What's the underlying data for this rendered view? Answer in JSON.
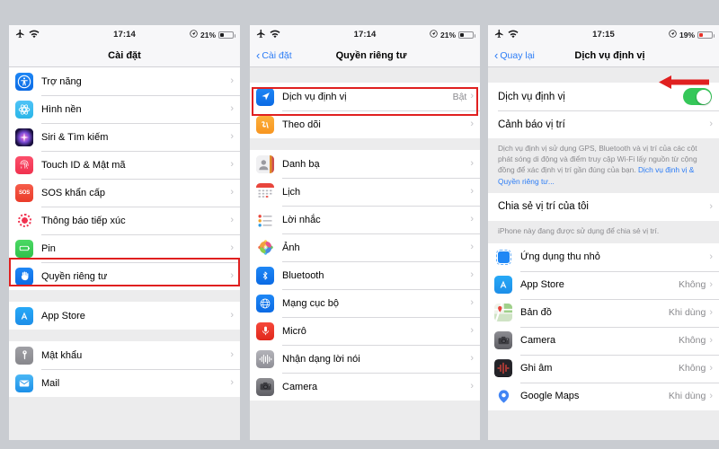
{
  "meta": {
    "background_color": "#c9ccd1",
    "accent_blue": "#2b7cf6",
    "highlight_red": "#e02020",
    "toggle_green": "#35c759"
  },
  "panel1": {
    "status": {
      "time": "17:14",
      "battery_percent": "21%",
      "airplane_icon": "airplane-icon",
      "wifi_icon": "wifi-icon",
      "location_icon": "location-arrow-icon"
    },
    "nav": {
      "title": "Cài đặt",
      "back_label": ""
    },
    "group1": [
      {
        "label": "Trợ năng",
        "icon": "accessibility-icon",
        "value": ""
      },
      {
        "label": "Hình nền",
        "icon": "wallpaper-icon",
        "value": ""
      },
      {
        "label": "Siri & Tìm kiếm",
        "icon": "siri-icon",
        "value": ""
      },
      {
        "label": "Touch ID & Mật mã",
        "icon": "touchid-icon",
        "value": ""
      },
      {
        "label": "SOS khẩn cấp",
        "icon": "sos-icon",
        "value": ""
      },
      {
        "label": "Thông báo tiếp xúc",
        "icon": "exposure-notification-icon",
        "value": ""
      },
      {
        "label": "Pin",
        "icon": "battery-icon",
        "value": ""
      },
      {
        "label": "Quyền riêng tư",
        "icon": "privacy-hand-icon",
        "value": ""
      }
    ],
    "group2": [
      {
        "label": "App Store",
        "icon": "app-store-icon",
        "value": ""
      }
    ],
    "group3": [
      {
        "label": "Mật khẩu",
        "icon": "passwords-key-icon",
        "value": ""
      },
      {
        "label": "Mail",
        "icon": "mail-icon",
        "value": ""
      }
    ]
  },
  "panel2": {
    "status": {
      "time": "17:14",
      "battery_percent": "21%"
    },
    "nav": {
      "back_label": "Cài đặt",
      "title": "Quyền riêng tư"
    },
    "group1": [
      {
        "label": "Dịch vụ định vị",
        "icon": "location-services-icon",
        "value": "Bật"
      },
      {
        "label": "Theo dõi",
        "icon": "tracking-icon",
        "value": ""
      }
    ],
    "group2": [
      {
        "label": "Danh bạ",
        "icon": "contacts-icon",
        "value": ""
      },
      {
        "label": "Lịch",
        "icon": "calendar-icon",
        "value": ""
      },
      {
        "label": "Lời nhắc",
        "icon": "reminders-icon",
        "value": ""
      },
      {
        "label": "Ảnh",
        "icon": "photos-icon",
        "value": ""
      },
      {
        "label": "Bluetooth",
        "icon": "bluetooth-icon",
        "value": ""
      },
      {
        "label": "Mạng cục bộ",
        "icon": "local-network-icon",
        "value": ""
      },
      {
        "label": "Micrô",
        "icon": "microphone-icon",
        "value": ""
      },
      {
        "label": "Nhận dạng lời nói",
        "icon": "speech-recognition-icon",
        "value": ""
      },
      {
        "label": "Camera",
        "icon": "camera-icon",
        "value": ""
      }
    ]
  },
  "panel3": {
    "status": {
      "time": "17:15",
      "battery_percent": "19%"
    },
    "nav": {
      "back_label": "Quay lại",
      "title": "Dịch vụ định vị"
    },
    "group1": [
      {
        "label": "Dịch vụ định vị",
        "value": "",
        "control": "toggle-on"
      },
      {
        "label": "Cảnh báo vị trí",
        "value": "",
        "control": "chevron"
      }
    ],
    "note1_text": "Dịch vụ định vị sử dụng GPS, Bluetooth và vị trí của các cột phát sóng di động và điểm truy cập Wi-Fi lấy nguồn từ cộng đồng để xác định vị trí gần đúng của bạn. ",
    "note1_link": "Dịch vụ định vị & Quyền riêng tư...",
    "group2": [
      {
        "label": "Chia sẻ vị trí của tôi",
        "value": "",
        "control": "chevron"
      }
    ],
    "note2_text": "iPhone này đang được sử dụng để chia sẻ vị trí.",
    "group3": [
      {
        "label": "Ứng dụng thu nhỏ",
        "icon": "app-clips-icon",
        "value": ""
      },
      {
        "label": "App Store",
        "icon": "app-store-icon",
        "value": "Không"
      },
      {
        "label": "Bản đồ",
        "icon": "maps-icon",
        "value": "Khi dùng"
      },
      {
        "label": "Camera",
        "icon": "camera-icon",
        "value": "Không"
      },
      {
        "label": "Ghi âm",
        "icon": "voice-memos-icon",
        "value": "Không"
      },
      {
        "label": "Google Maps",
        "icon": "google-maps-icon",
        "value": "Khi dùng"
      }
    ]
  },
  "annotations": {
    "highlight_privacy": "Quyền riêng tư",
    "highlight_location_services": "Dịch vụ định vị",
    "arrow": "red-arrow-pointing-left"
  }
}
